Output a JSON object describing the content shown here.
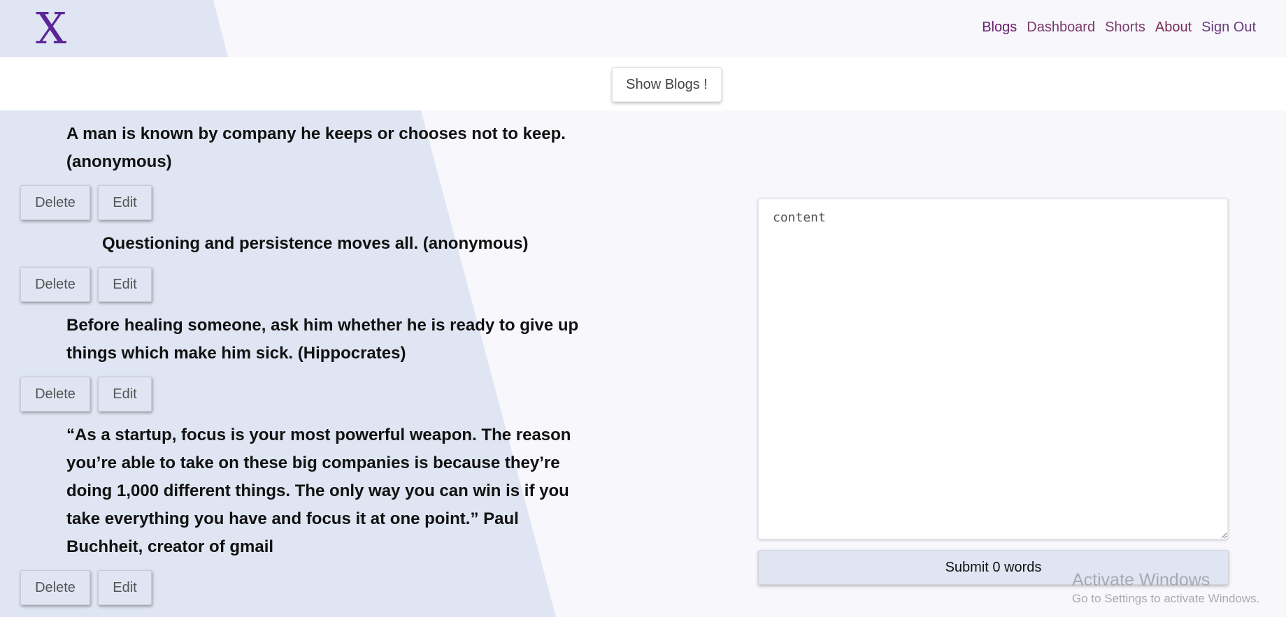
{
  "header": {
    "logo": "X",
    "nav": {
      "blogs": "Blogs",
      "dashboard": "Dashboard",
      "shorts": "Shorts",
      "about": "About",
      "sign_out": "Sign Out"
    }
  },
  "toolbar": {
    "show_blogs": "Show Blogs !"
  },
  "posts": [
    {
      "text": "A man is known by company he keeps or chooses not to keep. (anonymous)",
      "delete": "Delete",
      "edit": "Edit"
    },
    {
      "text": "Questioning and persistence moves all. (anonymous)",
      "delete": "Delete",
      "edit": "Edit"
    },
    {
      "text": "Before healing someone, ask him whether he is ready to give up things which make him sick. (Hippocrates)",
      "delete": "Delete",
      "edit": "Edit"
    },
    {
      "text": "“As a startup, focus is your most powerful weapon. The reason you’re able to take on these big companies is because they’re doing 1,000 different things. The only way you can win is if you take everything you have and focus it at one point.” Paul Buchheit, creator of gmail",
      "delete": "Delete",
      "edit": "Edit"
    }
  ],
  "editor": {
    "placeholder": "content",
    "submit": "Submit 0 words"
  },
  "watermark": {
    "title": "Activate Windows",
    "subtitle": "Go to Settings to activate Windows."
  },
  "colors": {
    "logo": "#5b2597",
    "nav_purple": "#6a1b6b",
    "nav_green": "#2f8a25",
    "panel_bg": "#dfe5f2",
    "page_bg": "#f7f7fc"
  }
}
